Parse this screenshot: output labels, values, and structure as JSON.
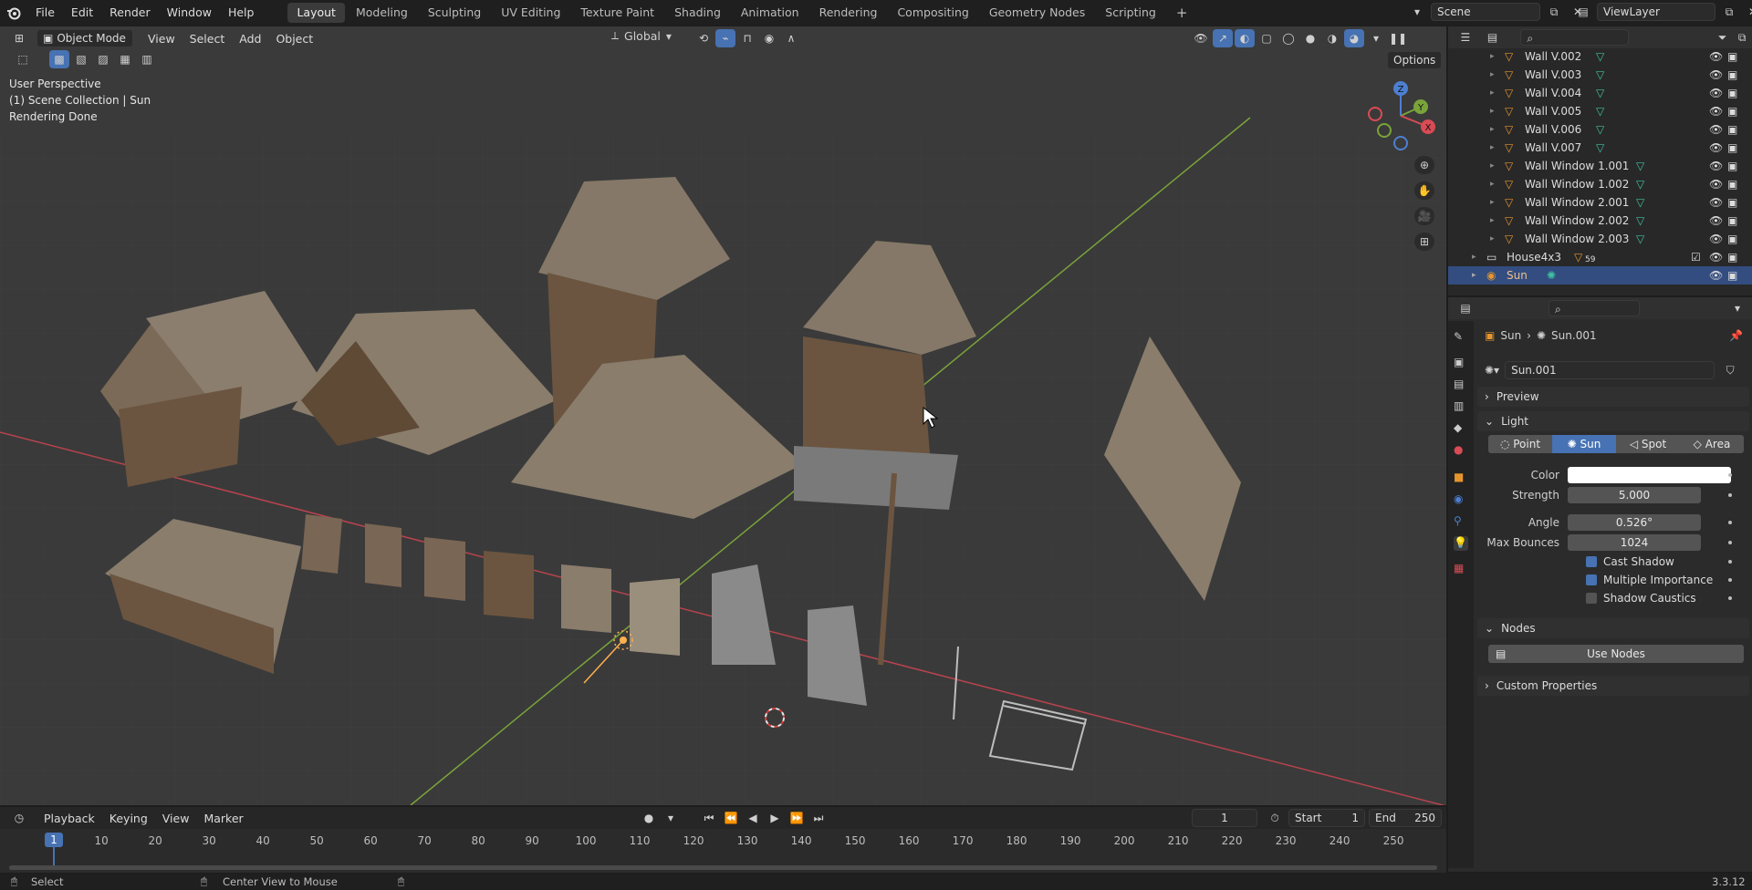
{
  "menu": {
    "file": "File",
    "edit": "Edit",
    "render": "Render",
    "window": "Window",
    "help": "Help"
  },
  "workspaces": [
    "Layout",
    "Modeling",
    "Sculpting",
    "UV Editing",
    "Texture Paint",
    "Shading",
    "Animation",
    "Rendering",
    "Compositing",
    "Geometry Nodes",
    "Scripting"
  ],
  "workspace_add": "+",
  "scene_name": "Scene",
  "view_layer": "ViewLayer",
  "viewport": {
    "mode": "Object Mode",
    "menus": {
      "view": "View",
      "select": "Select",
      "add": "Add",
      "object": "Object"
    },
    "orientation": "Global",
    "options": "Options",
    "overlay_line1": "User Perspective",
    "overlay_line2": "(1) Scene Collection | Sun",
    "overlay_line3": "Rendering Done",
    "gizmo": {
      "z": "Z",
      "y": "Y",
      "x": "X"
    }
  },
  "outliner": {
    "rows": [
      {
        "name": "Wall V.002"
      },
      {
        "name": "Wall V.003"
      },
      {
        "name": "Wall V.004"
      },
      {
        "name": "Wall V.005"
      },
      {
        "name": "Wall V.006"
      },
      {
        "name": "Wall V.007"
      },
      {
        "name": "Wall Window 1.001"
      },
      {
        "name": "Wall Window 1.002"
      },
      {
        "name": "Wall Window 2.001"
      },
      {
        "name": "Wall Window 2.002"
      },
      {
        "name": "Wall Window 2.003"
      }
    ],
    "collection": {
      "name": "House4x3",
      "count": "59"
    },
    "selected": {
      "name": "Sun"
    }
  },
  "properties": {
    "breadcrumb_object": "Sun",
    "breadcrumb_data": "Sun.001",
    "datablock": "Sun.001",
    "panels": {
      "preview": "Preview",
      "light": "Light",
      "nodes": "Nodes",
      "custom": "Custom Properties"
    },
    "light_types": [
      "Point",
      "Sun",
      "Spot",
      "Area"
    ],
    "active_light_type": "Sun",
    "labels": {
      "color": "Color",
      "strength": "Strength",
      "angle": "Angle",
      "max_bounces": "Max Bounces"
    },
    "values": {
      "strength": "5.000",
      "angle": "0.526°",
      "max_bounces": "1024"
    },
    "checks": [
      {
        "label": "Cast Shadow",
        "on": true
      },
      {
        "label": "Multiple Importance",
        "on": true
      },
      {
        "label": "Shadow Caustics",
        "on": false
      }
    ],
    "use_nodes": "Use Nodes",
    "color_value": "#ffffff"
  },
  "timeline": {
    "menus": {
      "playback": "Playback",
      "keying": "Keying",
      "view": "View",
      "marker": "Marker"
    },
    "current_frame": "1",
    "start_label": "Start",
    "start_value": "1",
    "end_label": "End",
    "end_value": "250",
    "ticks": [
      "1",
      "10",
      "20",
      "30",
      "40",
      "50",
      "60",
      "70",
      "80",
      "90",
      "100",
      "110",
      "120",
      "130",
      "140",
      "150",
      "160",
      "170",
      "180",
      "190",
      "200",
      "210",
      "220",
      "230",
      "240",
      "250"
    ]
  },
  "status": {
    "select": "Select",
    "center": "Center View to Mouse",
    "version": "3.3.12"
  },
  "colors": {
    "accent": "#4772b3",
    "selected_row": "#334d80",
    "mesh_icon": "#e6952d",
    "data_icon": "#3fc2a0"
  }
}
